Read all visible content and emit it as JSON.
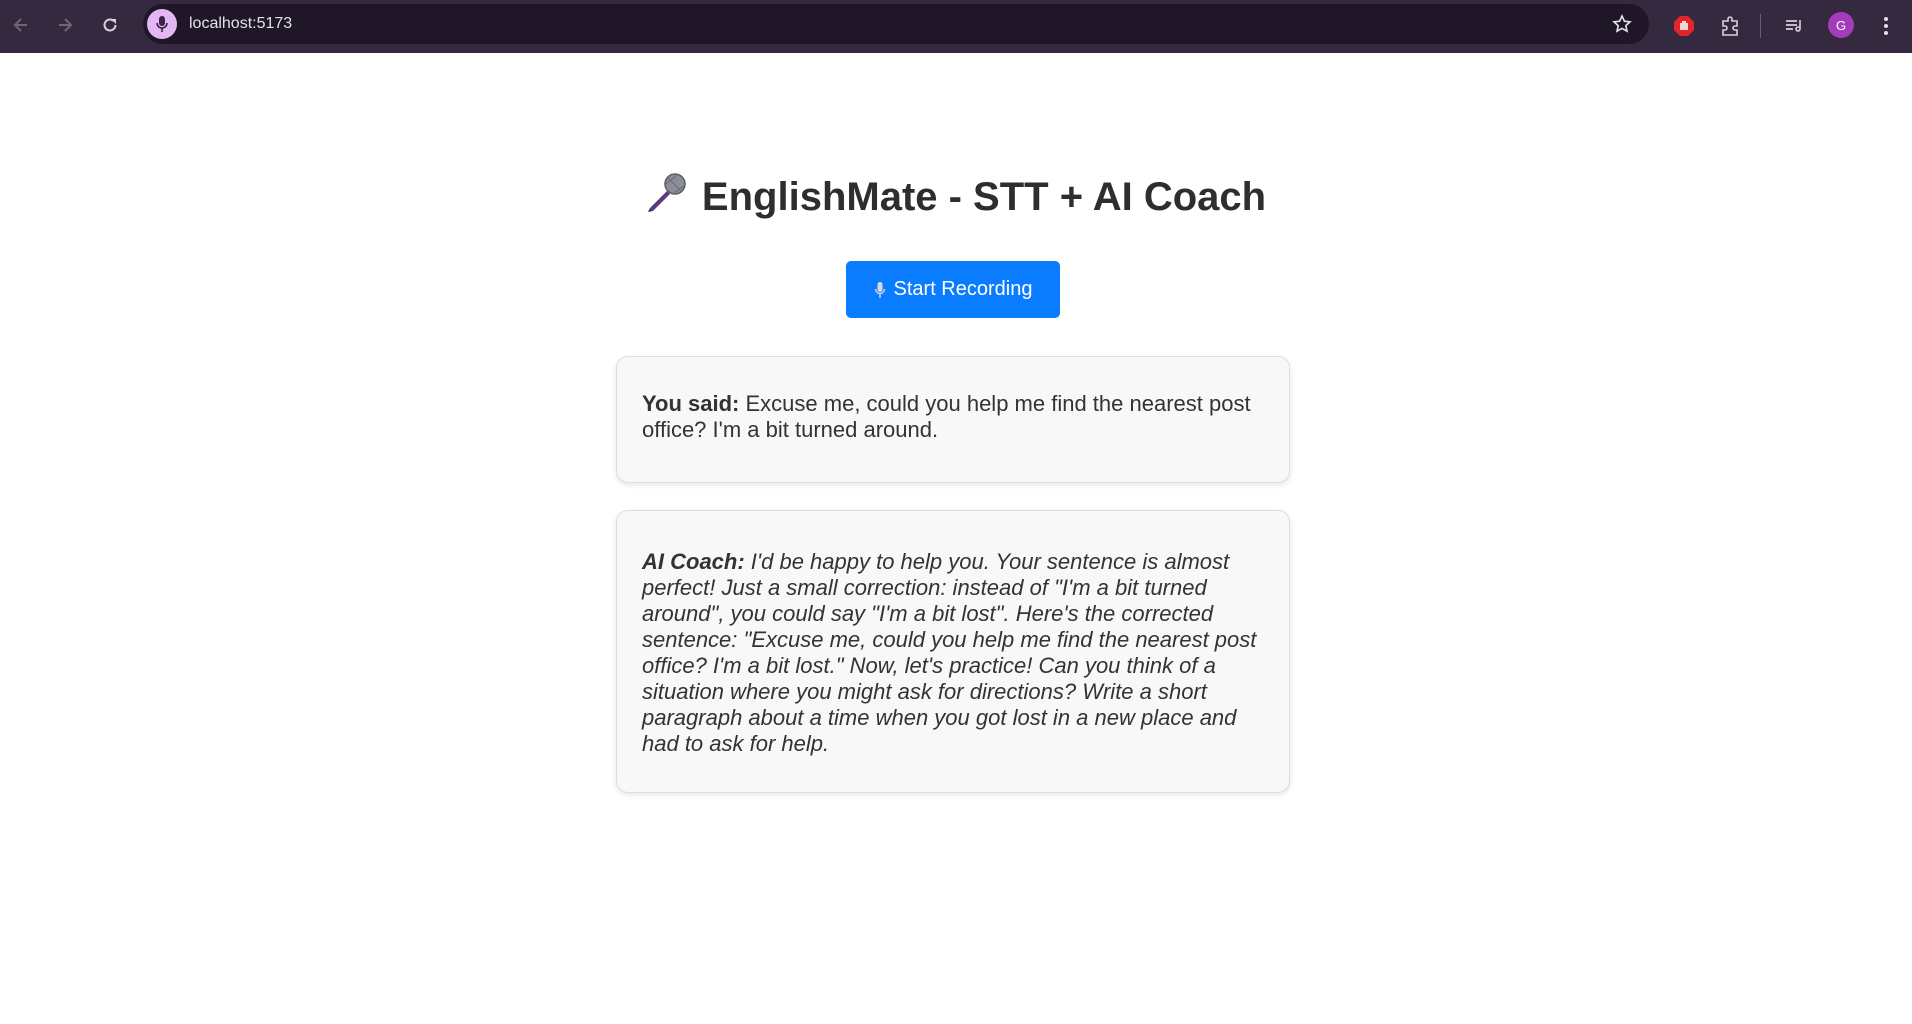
{
  "browser": {
    "url": "localhost:5173",
    "avatar_initial": "G"
  },
  "page": {
    "title": "EnglishMate - STT + AI Coach",
    "title_icon": "microphone-icon",
    "record_button": {
      "icon": "microphone-icon",
      "label": "Start Recording"
    },
    "user_card": {
      "label": "You said:",
      "text": " Excuse me, could you help me find the nearest post office? I'm a bit turned around."
    },
    "coach_card": {
      "label": "AI Coach:",
      "text": " I'd be happy to help you. Your sentence is almost perfect! Just a small correction: instead of \"I'm a bit turned around\", you could say \"I'm a bit lost\". Here's the corrected sentence: \"Excuse me, could you help me find the nearest post office? I'm a bit lost.\" Now, let's practice! Can you think of a situation where you might ask for directions? Write a short paragraph about a time when you got lost in a new place and had to ask for help."
    }
  },
  "colors": {
    "browser_toolbar": "#35293f",
    "primary_button": "#0a7cff",
    "card_background": "#f8f8f8"
  }
}
